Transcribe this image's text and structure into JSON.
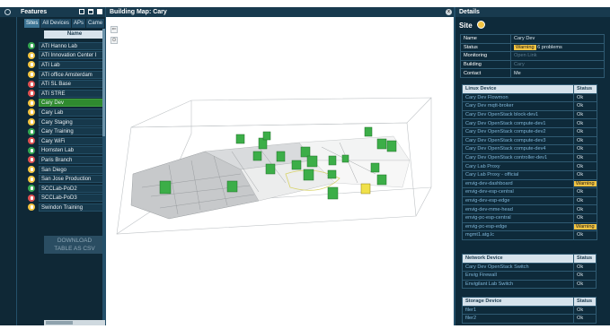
{
  "features_panel": {
    "title": "Features",
    "tabs": [
      "Sites",
      "All Devices",
      "APs",
      "Came"
    ],
    "column_header": "Name",
    "items": [
      {
        "name": "ATI Hanno Lab",
        "color": "#35a852"
      },
      {
        "name": "ATI Innovation Center I",
        "color": "#f4c542"
      },
      {
        "name": "ATI Lab",
        "color": "#f4c542"
      },
      {
        "name": "ATI office Amsterdam",
        "color": "#f4c542"
      },
      {
        "name": "ATI SL Base",
        "color": "#e05252"
      },
      {
        "name": "ATI STRE",
        "color": "#e05252"
      },
      {
        "name": "Cary Dev",
        "color": "#f4c542"
      },
      {
        "name": "Cary Lab",
        "color": "#f4c542"
      },
      {
        "name": "Cary Staging",
        "color": "#f4c542"
      },
      {
        "name": "Cary Training",
        "color": "#35a852"
      },
      {
        "name": "Cary WiFi",
        "color": "#e05252"
      },
      {
        "name": "Hornsten Lab",
        "color": "#35a852"
      },
      {
        "name": "Paris Branch",
        "color": "#e05252"
      },
      {
        "name": "San Diego",
        "color": "#f4c542"
      },
      {
        "name": "San Jose Production",
        "color": "#f4c542"
      },
      {
        "name": "SCCLab-PoD2",
        "color": "#35a852"
      },
      {
        "name": "SCCLab-PoD3",
        "color": "#e05252"
      },
      {
        "name": "Swindon Training",
        "color": "#f4c542"
      }
    ],
    "selected_index": 6,
    "download_label_1": "DOWNLOAD",
    "download_label_2": "TABLE AS CSV"
  },
  "map_panel": {
    "title": "Building Map: Cary",
    "close_glyph": "x",
    "nav_glyph": "⇐",
    "target_glyph": "⊙"
  },
  "details_panel": {
    "title": "Details",
    "site_label": "Site",
    "summary": [
      {
        "key": "Name",
        "value": "Cary Dev",
        "muted": false
      },
      {
        "key": "Status",
        "badge": "Warning",
        "value": "6 problems",
        "muted": false
      },
      {
        "key": "Monitoring",
        "value": "Open Link",
        "muted": true
      },
      {
        "key": "Building",
        "value": "Cary",
        "muted": true
      },
      {
        "key": "Contact",
        "value": "Me",
        "muted": false
      }
    ],
    "status_header": "Status",
    "linux": {
      "header": "Linux Device",
      "rows": [
        {
          "name": "Cary Dev Flowmon",
          "status": "Ok"
        },
        {
          "name": "Cary Dev mqtt-broker",
          "status": "Ok"
        },
        {
          "name": "Cary Dev OpenStack block-dev1",
          "status": "Ok"
        },
        {
          "name": "Cary Dev OpenStack compute-dev1",
          "status": "Ok"
        },
        {
          "name": "Cary Dev OpenStack compute-dev2",
          "status": "Ok"
        },
        {
          "name": "Cary Dev OpenStack compute-dev3",
          "status": "Ok"
        },
        {
          "name": "Cary Dev OpenStack compute-dev4",
          "status": "Ok"
        },
        {
          "name": "Cary Dev OpenStack controller-dev1",
          "status": "Ok"
        },
        {
          "name": "Cary Lab Proxy",
          "status": "Ok"
        },
        {
          "name": "Cary Lab Proxy - official",
          "status": "Ok"
        },
        {
          "name": "envig-dev-dashboard",
          "status": "Warning"
        },
        {
          "name": "envig-dev-esp-central",
          "status": "Ok"
        },
        {
          "name": "envig-dev-esp-edge",
          "status": "Ok"
        },
        {
          "name": "envig-dev-mme-head",
          "status": "Ok"
        },
        {
          "name": "envig-pc-esp-central",
          "status": "Ok"
        },
        {
          "name": "envig-pc-esp-edge",
          "status": "Warning"
        },
        {
          "name": "mgmt1.atg.lc",
          "status": "Ok"
        }
      ]
    },
    "network": {
      "header": "Network Device",
      "rows": [
        {
          "name": "Cary Dev OpenStack Switch",
          "status": "Ok"
        },
        {
          "name": "Envig Firewall",
          "status": "Ok"
        },
        {
          "name": "Envigilant Lab Switch",
          "status": "Ok"
        }
      ]
    },
    "storage": {
      "header": "Storage Device",
      "rows": [
        {
          "name": "filer1",
          "status": "Ok"
        },
        {
          "name": "filer2",
          "status": "Ok"
        }
      ]
    }
  },
  "colors": {
    "panel_bg": "#0e2a3a",
    "ok_green": "#35a852",
    "warning_yellow": "#f4c542",
    "error_red": "#e05252",
    "selected_row": "#2f8a2f"
  }
}
